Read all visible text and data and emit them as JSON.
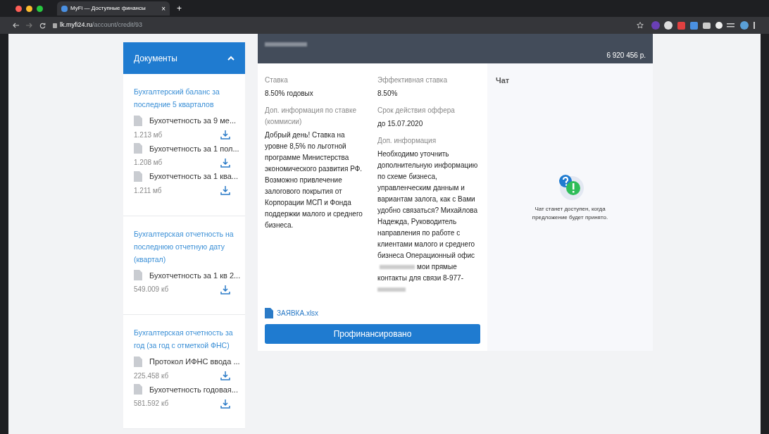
{
  "browser": {
    "tab_title": "MyFi — Доступные финансы",
    "tab_close": "×",
    "new_tab": "+",
    "url_host": "lk.myfi24.ru",
    "url_path": "/account/credit/93"
  },
  "sidebar": {
    "title": "Документы",
    "expanded": true,
    "groups": [
      {
        "title": "Бухгалтерский баланс за последние 5 кварталов",
        "files": [
          {
            "name": "Бухотчетность за 9 ме...",
            "size": "1.213 мб"
          },
          {
            "name": "Бухотчетность за 1 пол...",
            "size": "1.208 мб"
          },
          {
            "name": "Бухотчетность за 1 ква...",
            "size": "1.211 мб"
          }
        ]
      },
      {
        "title": "Бухгалтерская отчетность на последнюю отчетную дату (квартал)",
        "files": [
          {
            "name": "Бухотчетность за 1 кв 2...",
            "size": "549.009 кб"
          }
        ]
      },
      {
        "title": "Бухгалтерская отчетность за год (за год с отметкой ФНС)",
        "files": [
          {
            "name": "Протокол ИФНС ввода ...",
            "size": "225.458 кб"
          },
          {
            "name": "Бухотчетность годовая...",
            "size": "581.592 кб"
          }
        ]
      }
    ]
  },
  "offer": {
    "amount": "6 920 456 р.",
    "left": [
      {
        "label": "Ставка",
        "value": "8.50% годовых"
      },
      {
        "label": "Доп. информация по ставке (коммисии)",
        "value": "Добрый день! Ставка на уровне 8,5% по льготной программе Министерства экономического развития РФ. Возможно привлечение залогового покрытия от Корпорации МСП и Фонда поддержки малого и среднего бизнеса."
      }
    ],
    "right": [
      {
        "label": "Эффективная ставка",
        "value": "8.50%"
      },
      {
        "label": "Срок действия оффера",
        "value": "до 15.07.2020"
      },
      {
        "label": "Доп. информация",
        "value": "Необходимо уточнить дополнительную информацию по схеме бизнеса, управленческим данным и вариантам залога, как с Вами удобно связаться? Михайлова Надежда, Руководитель направления по работе с клиентами малого и среднего бизнеса Операционный офис",
        "value_tail": "мои прямые контакты для связи 8-977-"
      }
    ],
    "attachment": "ЗАЯВКА.xlsx",
    "button": "Профинансировано"
  },
  "chat": {
    "title": "Чат",
    "message": "Чат станет доступен, когда предложение будет принято."
  }
}
